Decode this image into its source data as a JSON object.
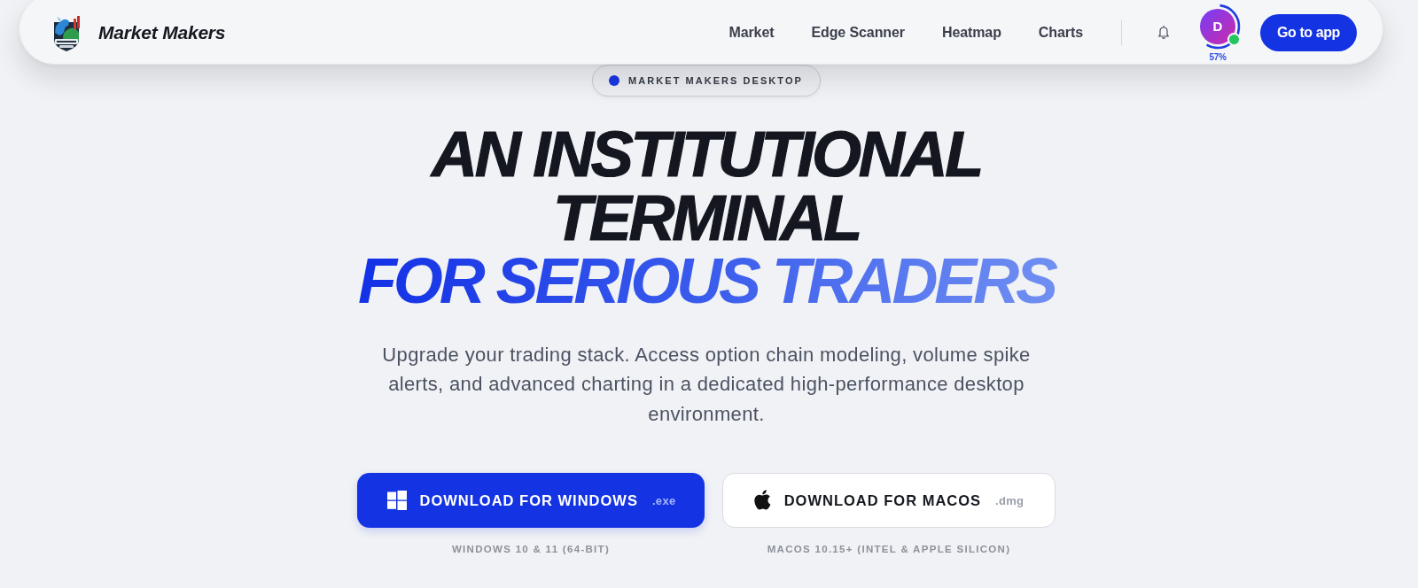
{
  "navbar": {
    "brand": "Market Makers",
    "links": [
      "Market",
      "Edge Scanner",
      "Heatmap",
      "Charts"
    ],
    "profile": {
      "initial": "D",
      "level": 0.57,
      "reading": "57%",
      "online": true
    },
    "cta": "Go to app"
  },
  "hero": {
    "badge": "MARKET MAKERS DESKTOP",
    "headline": {
      "lines": [
        "AN INSTITUTIONAL",
        "TERMINAL"
      ],
      "accent": "FOR SERIOUS TRADERS"
    },
    "description": "Upgrade your trading stack. Access option chain modeling, volume spike alerts, and advanced charting in a dedicated high-performance desktop environment.",
    "downloads": [
      {
        "kind": "windows",
        "label": "DOWNLOAD FOR WINDOWS",
        "extension": ".exe",
        "caption": "WINDOWS 10 & 11 (64-BIT)",
        "primary": true
      },
      {
        "kind": "macos",
        "label": "DOWNLOAD FOR MACOS",
        "extension": ".dmg",
        "caption": "MACOS 10.15+ (INTEL & APPLE SILICON)",
        "primary": false
      }
    ]
  }
}
